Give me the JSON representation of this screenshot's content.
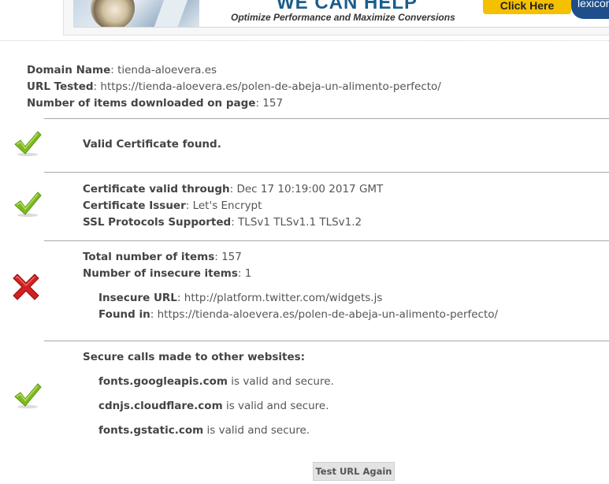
{
  "ad": {
    "headline": "WE CAN HELP",
    "tagline": "Optimize Performance and Maximize Conversions",
    "cta": "Click Here",
    "logo": "lexiconn"
  },
  "info": {
    "domain_label": "Domain Name",
    "domain_value": "tienda-aloevera.es",
    "url_label": "URL Tested",
    "url_value": "https://tienda-aloevera.es/polen-de-abeja-un-alimento-perfecto/",
    "items_label": "Number of items downloaded on page",
    "items_value": "157"
  },
  "certificate": {
    "status_icon": "check-icon",
    "found_text": "Valid Certificate found."
  },
  "details": {
    "status_icon": "check-icon",
    "valid_label": "Certificate valid through",
    "valid_value": "Dec 17 10:19:00 2017 GMT",
    "issuer_label": "Certificate Issuer",
    "issuer_value": "Let's Encrypt",
    "protocols_label": "SSL Protocols Supported",
    "protocols_value": "TLSv1 TLSv1.1 TLSv1.2"
  },
  "insecure": {
    "status_icon": "cross-icon",
    "total_label": "Total number of items",
    "total_value": "157",
    "insecure_label": "Number of insecure items",
    "insecure_value": "1",
    "url_label": "Insecure URL",
    "url_value": "http://platform.twitter.com/widgets.js",
    "found_label": "Found in",
    "found_value": "https://tienda-aloevera.es/polen-de-abeja-un-alimento-perfecto/"
  },
  "secure_calls": {
    "status_icon": "check-icon",
    "heading": "Secure calls made to other websites:",
    "suffix": "is valid and secure.",
    "sites": [
      "fonts.googleapis.com",
      "cdnjs.cloudflare.com",
      "fonts.gstatic.com"
    ]
  },
  "actions": {
    "test_again": "Test URL Again"
  },
  "colors": {
    "check": "#7dbb1e",
    "cross": "#d42020",
    "button_bg": "#e3e3e3"
  }
}
